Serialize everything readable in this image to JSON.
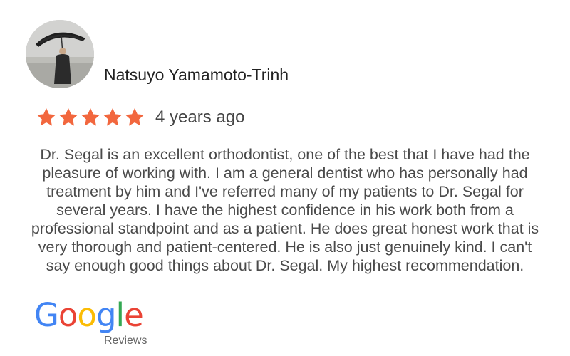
{
  "reviewer": {
    "name": "Natsuyo Yamamoto-Trinh",
    "avatar_icon": "reviewer-photo"
  },
  "rating": {
    "stars": 5,
    "max_stars": 5,
    "star_color": "#f2673e",
    "time_ago": "4 years ago"
  },
  "review": {
    "text": "Dr. Segal is an excellent orthodontist, one of the best that I have had the pleasure of working with. I am a general dentist who has personally had treatment by him and I've referred many of my patients to Dr. Segal for several years. I have the highest confidence in his work both from a professional standpoint and as a patient. He does great honest work that is very thorough and patient-centered. He is also just genuinely kind. I can't say enough good things about Dr. Segal. My highest recommendation."
  },
  "branding": {
    "logo_letters": [
      "G",
      "o",
      "o",
      "g",
      "l",
      "e"
    ],
    "logo_colors": [
      "#4285F4",
      "#EA4335",
      "#FBBC05",
      "#4285F4",
      "#34A853",
      "#EA4335"
    ],
    "caption": "Reviews"
  }
}
